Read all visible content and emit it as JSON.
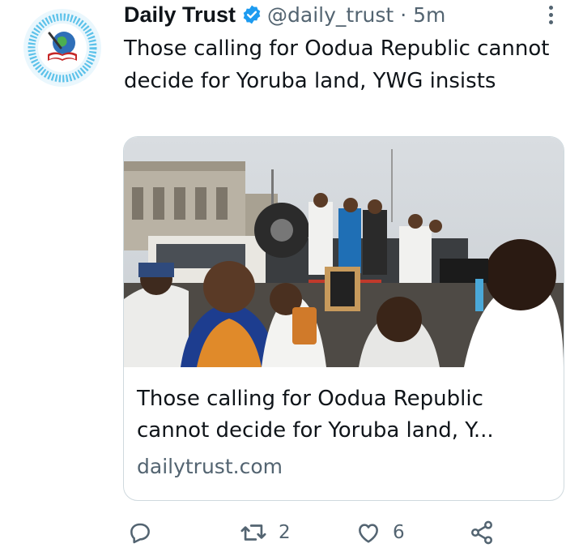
{
  "tweet": {
    "author_name": "Daily Trust",
    "handle": "@daily_trust",
    "separator": "·",
    "time": "5m",
    "text": "Those calling for Oodua Republic cannot decide for Yoruba land, YWG insists",
    "verified_color": "#1d9bf0"
  },
  "card": {
    "image_alt": "crowd-on-truck-photo",
    "title": "Those calling for Oodua Republic cannot decide for Yoruba land, Y...",
    "domain": "dailytrust.com"
  },
  "actions": {
    "reply_count": "",
    "retweet_count": "2",
    "like_count": "6"
  },
  "icons": [
    "verified-badge-icon",
    "more-options-icon",
    "reply-icon",
    "retweet-icon",
    "like-icon",
    "share-icon"
  ],
  "colors": {
    "text": "#0f1419",
    "secondary": "#536471",
    "accent": "#1d9bf0",
    "border": "#cfd9de"
  }
}
